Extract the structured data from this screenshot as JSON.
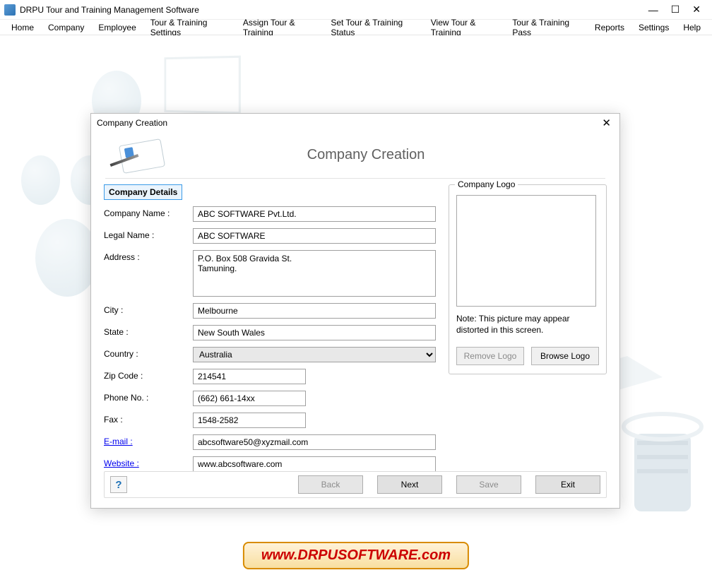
{
  "app": {
    "title": "DRPU Tour and Training Management Software"
  },
  "menubar": [
    "Home",
    "Company",
    "Employee",
    "Tour & Training Settings",
    "Assign Tour & Training",
    "Set Tour & Training Status",
    "View Tour & Training",
    "Tour & Training Pass",
    "Reports",
    "Settings",
    "Help"
  ],
  "dialog": {
    "title": "Company Creation",
    "banner_title": "Company Creation",
    "section_label": "Company Details",
    "fields": {
      "company_name_label": "Company Name :",
      "company_name": "ABC SOFTWARE Pvt.Ltd.",
      "legal_name_label": "Legal Name :",
      "legal_name": "ABC SOFTWARE",
      "address_label": "Address :",
      "address": "P.O. Box 508 Gravida St.\nTamuning.",
      "city_label": "City :",
      "city": "Melbourne",
      "state_label": "State :",
      "state": "New South Wales",
      "country_label": "Country :",
      "country": "Australia",
      "zip_label": "Zip Code :",
      "zip": "214541",
      "phone_label": "Phone No. :",
      "phone": "(662) 661-14xx",
      "fax_label": "Fax :",
      "fax": "1548-2582",
      "email_label": "E-mail :",
      "email": "abcsoftware50@xyzmail.com",
      "website_label": "Website :",
      "website": "www.abcsoftware.com"
    },
    "logo_panel": {
      "legend": "Company Logo",
      "note": "Note: This picture may appear distorted in this screen.",
      "remove_label": "Remove Logo",
      "browse_label": "Browse Logo"
    },
    "footer": {
      "help": "?",
      "back": "Back",
      "next": "Next",
      "save": "Save",
      "exit": "Exit"
    }
  },
  "watermark": "www.DRPUSOFTWARE.com"
}
